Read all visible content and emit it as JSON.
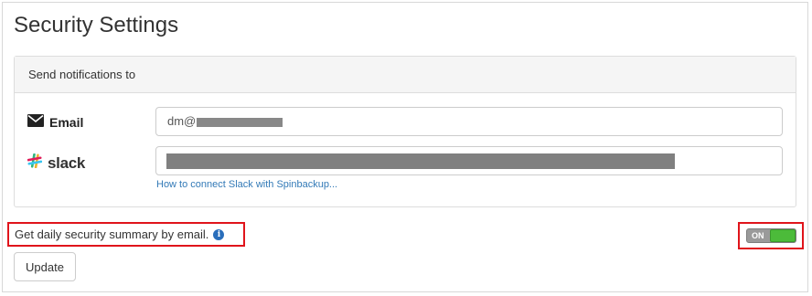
{
  "page": {
    "title": "Security Settings"
  },
  "notifications": {
    "heading": "Send notifications to",
    "email": {
      "label": "Email",
      "icon": "envelope-icon",
      "value_visible": "dm@"
    },
    "slack": {
      "label": "slack",
      "icon": "slack-icon",
      "help_link": "How to connect Slack with Spinbackup..."
    }
  },
  "daily_summary": {
    "label": "Get daily security summary by email.",
    "info_icon": "info-icon",
    "toggle_state": "ON"
  },
  "actions": {
    "update_label": "Update"
  },
  "colors": {
    "highlight": "#e0141b",
    "link": "#337ab7",
    "toggle_on": "#4cbb3a"
  }
}
